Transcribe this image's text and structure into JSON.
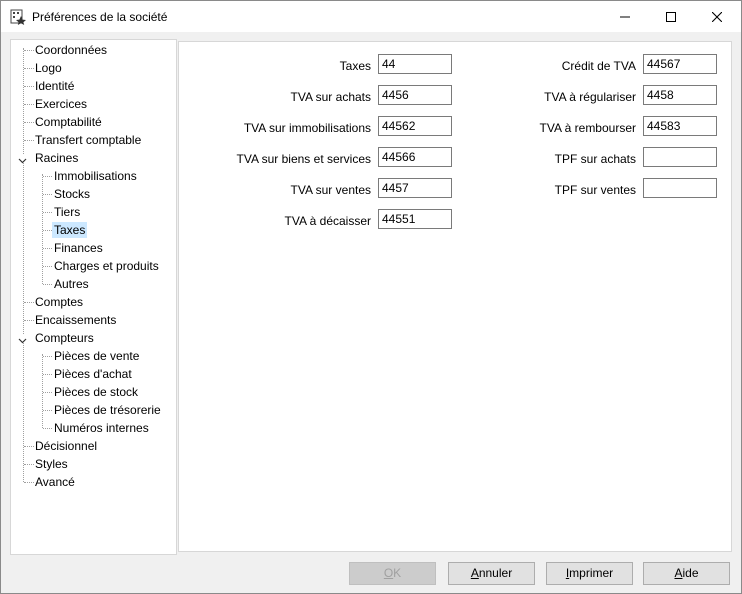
{
  "window": {
    "title": "Préférences de la société"
  },
  "tree": {
    "items": [
      {
        "label": "Coordonnées"
      },
      {
        "label": "Logo"
      },
      {
        "label": "Identité"
      },
      {
        "label": "Exercices"
      },
      {
        "label": "Comptabilité"
      },
      {
        "label": "Transfert comptable"
      },
      {
        "label": "Racines"
      },
      {
        "label": "Immobilisations"
      },
      {
        "label": "Stocks"
      },
      {
        "label": "Tiers"
      },
      {
        "label": "Taxes"
      },
      {
        "label": "Finances"
      },
      {
        "label": "Charges et produits"
      },
      {
        "label": "Autres"
      },
      {
        "label": "Comptes"
      },
      {
        "label": "Encaissements"
      },
      {
        "label": "Compteurs"
      },
      {
        "label": "Pièces de vente"
      },
      {
        "label": "Pièces d'achat"
      },
      {
        "label": "Pièces de stock"
      },
      {
        "label": "Pièces de trésorerie"
      },
      {
        "label": "Numéros internes"
      },
      {
        "label": "Décisionnel"
      },
      {
        "label": "Styles"
      },
      {
        "label": "Avancé"
      }
    ]
  },
  "form": {
    "left": [
      {
        "label": "Taxes",
        "value": "44"
      },
      {
        "label": "TVA sur achats",
        "value": "4456"
      },
      {
        "label": "TVA sur immobilisations",
        "value": "44562"
      },
      {
        "label": "TVA sur biens et services",
        "value": "44566"
      },
      {
        "label": "TVA sur ventes",
        "value": "4457"
      },
      {
        "label": "TVA à décaisser",
        "value": "44551"
      }
    ],
    "right": [
      {
        "label": "Crédit de TVA",
        "value": "44567"
      },
      {
        "label": "TVA à régulariser",
        "value": "4458"
      },
      {
        "label": "TVA à rembourser",
        "value": "44583"
      },
      {
        "label": "TPF sur achats",
        "value": ""
      },
      {
        "label": "TPF sur ventes",
        "value": ""
      }
    ]
  },
  "buttons": {
    "ok": {
      "first": "O",
      "rest": "K"
    },
    "cancel": {
      "first": "A",
      "rest": "nnuler"
    },
    "print": {
      "first": "I",
      "rest": "mprimer"
    },
    "help": {
      "first": "A",
      "rest": "ide"
    }
  }
}
